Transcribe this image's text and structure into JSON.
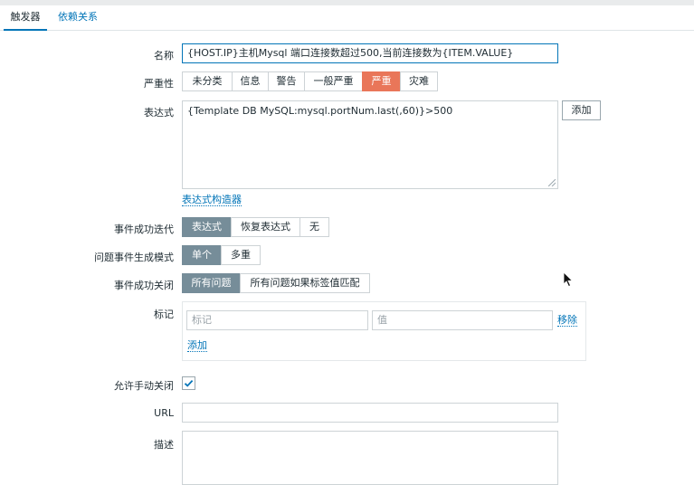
{
  "tabs": [
    {
      "label": "触发器"
    },
    {
      "label": "依赖关系"
    }
  ],
  "form": {
    "name": {
      "label": "名称",
      "value": "{HOST.IP}主机Mysql 端口连接数超过500,当前连接数为{ITEM.VALUE}"
    },
    "severity": {
      "label": "严重性",
      "options": [
        "未分类",
        "信息",
        "警告",
        "一般严重",
        "严重",
        "灾难"
      ],
      "selected": "严重",
      "selected_color": "#e97659"
    },
    "expression": {
      "label": "表达式",
      "value": "{Template DB MySQL:mysql.portNum.last(,60)}>500",
      "add_button": "添加",
      "builder_link": "表达式构造器"
    },
    "ok_event_generation": {
      "label": "事件成功迭代",
      "options": [
        "表达式",
        "恢复表达式",
        "无"
      ],
      "selected": "表达式"
    },
    "problem_event_mode": {
      "label": "问题事件生成模式",
      "options": [
        "单个",
        "多重"
      ],
      "selected": "单个"
    },
    "ok_event_closes": {
      "label": "事件成功关闭",
      "options": [
        "所有问题",
        "所有问题如果标签值匹配"
      ],
      "selected": "所有问题"
    },
    "tags": {
      "label": "标记",
      "tag_placeholder": "标记",
      "value_placeholder": "值",
      "remove_link": "移除",
      "add_link": "添加"
    },
    "manual_close": {
      "label": "允许手动关闭",
      "checked": true
    },
    "url": {
      "label": "URL",
      "value": ""
    },
    "description": {
      "label": "描述",
      "value": ""
    }
  },
  "colors": {
    "accent": "#0275b8",
    "selected_segment": "#768d99",
    "severity_high": "#e97659"
  }
}
